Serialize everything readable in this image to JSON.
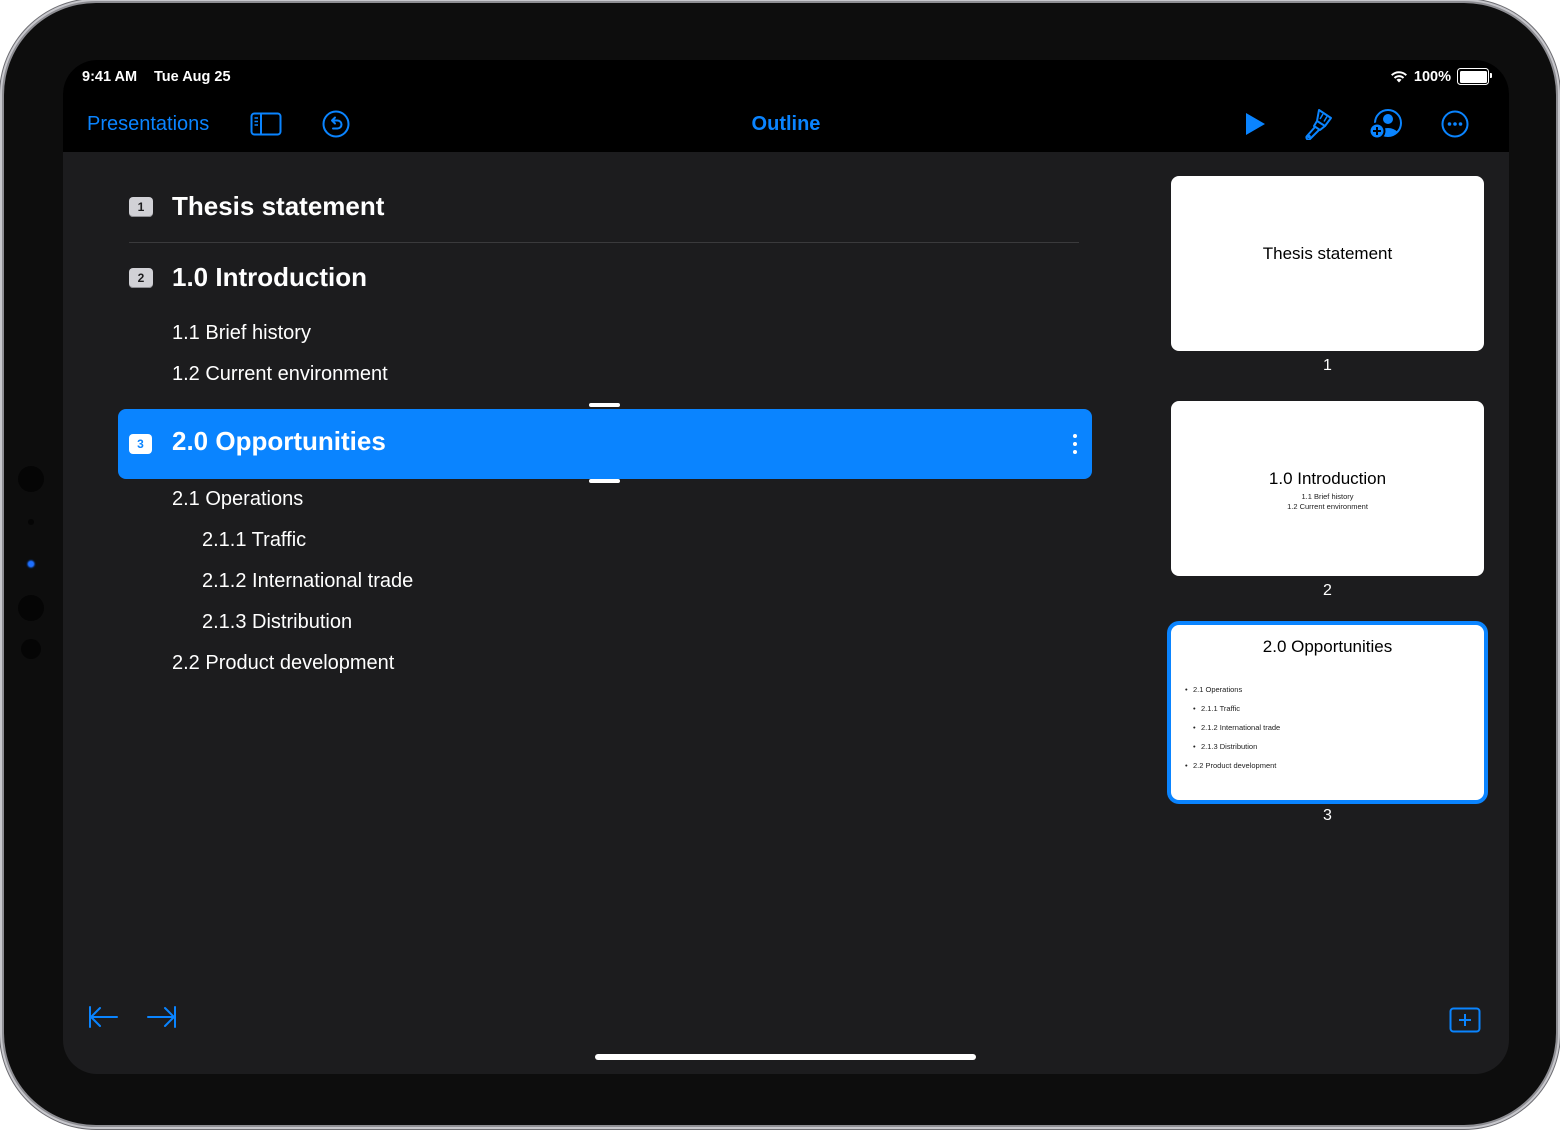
{
  "status_bar": {
    "time": "9:41 AM",
    "date": "Tue Aug 25",
    "battery": "100%",
    "battery_level": 1.0,
    "wifi_icon": "wifi-icon"
  },
  "toolbar": {
    "back_label": "Presentations",
    "sidebar_icon": "sidebar-toggle-icon",
    "undo_icon": "undo-icon",
    "title": "Outline",
    "play_icon": "play-icon",
    "format_icon": "paintbrush-icon",
    "collaborate_icon": "add-collaborator-icon",
    "more_icon": "more-icon"
  },
  "accent_color": "#0a84ff",
  "outline": {
    "slides": [
      {
        "number": "1",
        "title": "Thesis statement",
        "items": []
      },
      {
        "number": "2",
        "title": "1.0 Introduction",
        "items": [
          {
            "level": 1,
            "text": "1.1 Brief history"
          },
          {
            "level": 1,
            "text": "1.2 Current environment"
          }
        ]
      },
      {
        "number": "3",
        "title": "2.0 Opportunities",
        "selected": true,
        "items": [
          {
            "level": 1,
            "text": "2.1 Operations"
          },
          {
            "level": 2,
            "text": "2.1.1 Traffic"
          },
          {
            "level": 2,
            "text": "2.1.2 International trade"
          },
          {
            "level": 2,
            "text": "2.1.3 Distribution"
          },
          {
            "level": 1,
            "text": "2.2 Product development"
          }
        ]
      }
    ]
  },
  "navigator": {
    "thumbnails": [
      {
        "number": "1",
        "title": "Thesis statement",
        "subtitle": []
      },
      {
        "number": "2",
        "title": "1.0 Introduction",
        "subtitle": [
          "1.1 Brief history",
          "1.2 Current environment"
        ]
      },
      {
        "number": "3",
        "title": "2.0 Opportunities",
        "bullets": [
          {
            "level": 1,
            "text": "2.1 Operations"
          },
          {
            "level": 2,
            "text": "2.1.1 Traffic"
          },
          {
            "level": 2,
            "text": "2.1.2 International trade"
          },
          {
            "level": 2,
            "text": "2.1.3 Distribution"
          },
          {
            "level": 1,
            "text": "2.2 Product development"
          }
        ]
      }
    ]
  },
  "bottom_bar": {
    "outdent_icon": "outdent-icon",
    "indent_icon": "indent-icon",
    "add_slide_icon": "add-slide-icon"
  }
}
